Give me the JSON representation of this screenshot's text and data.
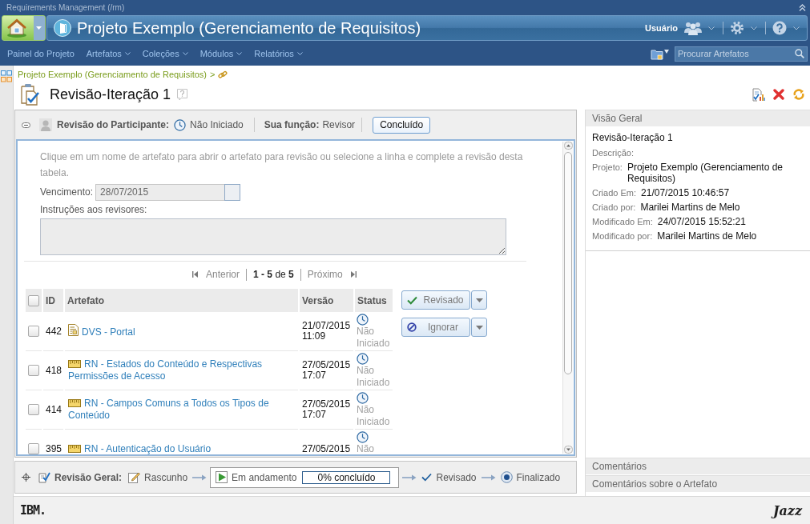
{
  "app_bar": {
    "title": "Requirements Management (/rm)"
  },
  "banner": {
    "project_title": "Projeto Exemplo (Gerenciamento de Requisitos)",
    "user_label": "Usuário"
  },
  "nav": {
    "items": [
      {
        "label": "Painel do Projeto",
        "menu": false
      },
      {
        "label": "Artefatos",
        "menu": true
      },
      {
        "label": "Coleções",
        "menu": true
      },
      {
        "label": "Módulos",
        "menu": true
      },
      {
        "label": "Relatórios",
        "menu": true
      }
    ],
    "search": {
      "placeholder": "Procurar Artefatos"
    }
  },
  "breadcrumb": {
    "items": [
      "Projeto Exemplo (Gerenciamento de Requisitos)"
    ],
    "separator": ">"
  },
  "page": {
    "title": "Revisão-Iteração 1"
  },
  "participant_review": {
    "expanded": true,
    "label": "Revisão do Participante:",
    "status": "Não Iniciado",
    "role_label": "Sua função:",
    "role": "Revisor",
    "done_button": "Concluído",
    "instructions": "Clique em um nome de artefato para abrir o artefato para revisão ou selecione a linha e complete a revisão desta tabela.",
    "due_label": "Vencimento:",
    "due_date": {
      "value": "28/07/2015",
      "disabled": true
    },
    "reviewer_notes": {
      "label": "Instruções aos revisores:",
      "disabled": true
    },
    "pagination": {
      "previous": {
        "label": "Anterior",
        "disabled": true
      },
      "range": "**1 - 5** de **5**",
      "next": {
        "label": "Próximo",
        "disabled": true
      }
    },
    "table": {
      "columns": [
        "ID",
        "Artefato",
        "Versão",
        "Status"
      ],
      "all_checked": false,
      "rows": [
        {
          "checked": false,
          "id": "442",
          "kind": "document",
          "artifact": "DVS - Portal",
          "version": "21/07/2015 11:09",
          "status": "Não Iniciado"
        },
        {
          "checked": false,
          "id": "418",
          "kind": "requirement",
          "artifact": "RN - Estados do Conteúdo e Respectivas Permissões de Acesso",
          "version": "27/05/2015 17:07",
          "status": "Não Iniciado"
        },
        {
          "checked": false,
          "id": "414",
          "kind": "requirement",
          "artifact": "RN - Campos Comuns a Todos os Tipos de Conteúdo",
          "version": "27/05/2015 17:07",
          "status": "Não Iniciado"
        },
        {
          "checked": false,
          "id": "395",
          "kind": "requirement",
          "artifact": "RN - Autenticação do Usuário",
          "version": "27/05/2015",
          "status": "Não"
        }
      ]
    },
    "actions": [
      {
        "label": "Revisado",
        "kind": "approve",
        "disabled": true
      },
      {
        "label": "Ignorar",
        "kind": "skip",
        "disabled": true
      }
    ]
  },
  "overall_review": {
    "expanded": false,
    "label": "Revisão Geral:",
    "steps": [
      {
        "label": "Rascunho",
        "kind": "draft",
        "selected": false
      },
      {
        "label": "Em andamento",
        "kind": "progress",
        "selected": true,
        "progress": {
          "level": 0,
          "reading": "0% concluído"
        }
      },
      {
        "label": "Revisado",
        "kind": "reviewed",
        "selected": false
      },
      {
        "label": "Finalizado",
        "kind": "final",
        "selected": false
      }
    ]
  },
  "overview": {
    "title": "Visão Geral",
    "name": "Revisão-Iteração 1",
    "fields": [
      {
        "label": "Descrição:"
      },
      {
        "label": "Projeto:",
        "value": "Projeto Exemplo (Gerenciamento de Requisitos)"
      },
      {
        "label": "Criado Em:",
        "value": "21/07/2015 10:46:57"
      },
      {
        "label": "Criado por:",
        "value": "Marilei Martins de Melo"
      },
      {
        "label": "Modificado Em:",
        "value": "24/07/2015 15:52:21"
      },
      {
        "label": "Modificado por:",
        "value": "Marilei Martins de Melo"
      }
    ]
  },
  "side_sections": [
    "Comentários",
    "Comentários sobre o Artefato"
  ],
  "footer": {
    "left_logo": "IBM.",
    "right_logo": "Jazz"
  }
}
